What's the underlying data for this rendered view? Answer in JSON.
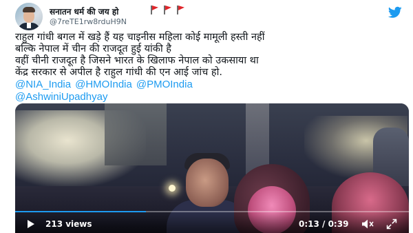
{
  "tweet": {
    "display_name": "सनातन धर्म की जय हो",
    "handle": "@7reTE1rw8rduH9N",
    "flags": [
      "red-flag-icon",
      "red-flag-icon",
      "red-flag-icon"
    ],
    "logo": "twitter-bird-icon",
    "text_lines": [
      "राहुल गांधी बगल में खड़े हैं यह चाइनीस महिला कोई मामूली हस्ती नहीं",
      "बल्कि नेपाल में चीन की राजदूत हुई यांकी है",
      "वहीं चीनी राजदूत है जिसने भारत के खिलाफ नेपाल को उकसाया था",
      "केंद्र सरकार से अपील है राहुल गांधी की एन आई जांच हो."
    ],
    "mentions_row1": [
      "@NIA_India",
      "@HMOIndia",
      "@PMOIndia"
    ],
    "mentions_row2": [
      "@AshwiniUpadhyay"
    ]
  },
  "video": {
    "views": "213 views",
    "time": "0:13 / 0:39",
    "progress": 0.333,
    "play_icon": "play-icon",
    "mute_icon": "mute-icon",
    "expand_icon": "expand-icon",
    "accent_color": "#1d9bf0"
  }
}
